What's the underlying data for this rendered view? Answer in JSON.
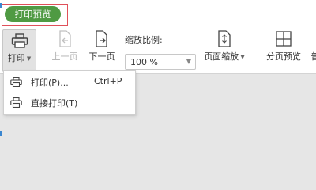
{
  "title_tab": {
    "label": "打印预览"
  },
  "toolbar": {
    "print": {
      "label": "打印"
    },
    "prev_page": {
      "label": "上一页",
      "disabled": true
    },
    "next_page": {
      "label": "下一页"
    },
    "zoom": {
      "label": "缩放比例:",
      "value": "100 %"
    },
    "page_zoom": {
      "label": "页面缩放"
    },
    "page_break_preview": {
      "label": "分页预览"
    },
    "cut_off": {
      "label": "普"
    }
  },
  "print_menu": {
    "items": [
      {
        "label": "打印(P)...",
        "shortcut": "Ctrl+P",
        "icon": "printer-icon"
      },
      {
        "label": "直接打印(T)",
        "shortcut": "",
        "icon": "printer-icon"
      }
    ]
  },
  "colors": {
    "title_pill": "#4f9a43",
    "highlight_box": "#e0505a",
    "background": "#e6e6e6"
  }
}
